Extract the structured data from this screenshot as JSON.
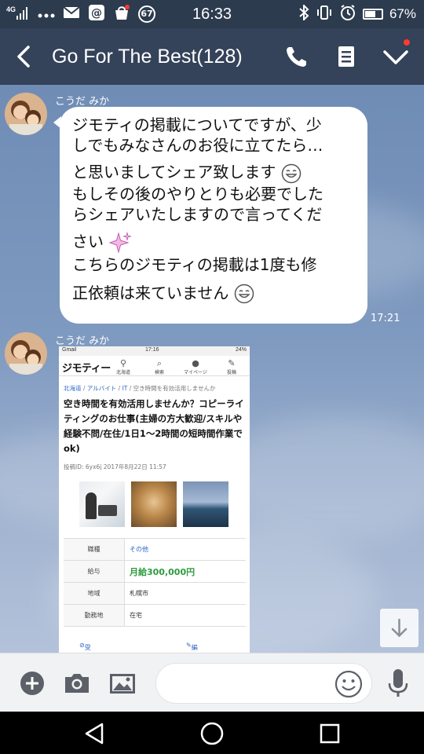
{
  "status_bar": {
    "network_type": "4G",
    "notification_count": "67",
    "time": "16:33",
    "battery_percent": "67%",
    "battery_level": 0.67
  },
  "header": {
    "title": "Go For The Best(128)"
  },
  "chat": {
    "messages": [
      {
        "sender": "こうだ みか",
        "lines": [
          "ジモティの掲載についてですが、少",
          "しでもみなさんのお役に立てたら…",
          "と思いましてシェア致します",
          "もしその後のやりとりも必要でした",
          "らシェアいたしますので言ってくだ",
          "さい",
          "こちらのジモティの掲載は1度も修",
          "正依頼は来ていません"
        ],
        "time": "17:21"
      },
      {
        "sender": "こうだ みか"
      }
    ]
  },
  "shared_screenshot": {
    "status_carrier": "Gmail",
    "status_time": "17:16",
    "status_battery": "24%",
    "logo": "ジモティー",
    "nav": [
      "北海道",
      "検索",
      "マイページ",
      "投稿"
    ],
    "breadcrumb": [
      "北海道",
      "アルバイト",
      "IT",
      "空き時間を有効活用しませんか"
    ],
    "title": "空き時間を有効活用しませんか？コピーライティングのお仕事(主婦の方大歓迎/スキルや経験不問/在住/1日1〜2時間の短時間作業でok)",
    "post_id": "投稿ID: 6yx6j 2017年8月22日 11:57",
    "table": [
      {
        "label": "職種",
        "value": "その他"
      },
      {
        "label": "給与",
        "value": "月給300,000円"
      },
      {
        "label": "地域",
        "value": "札幌市"
      },
      {
        "label": "勤務地",
        "value": "在宅"
      }
    ],
    "footer_left": "受付を終了",
    "footer_right": "編集"
  },
  "input": {
    "placeholder": ""
  },
  "colors": {
    "header_bg": "#34425a",
    "status_bg": "#2d3b4e",
    "chat_bg": "#7a93b8",
    "bubble_bg": "#ffffff",
    "link_blue": "#2a66c4",
    "salary_green": "#2e9a3e"
  },
  "icons": {
    "header": [
      "back-arrow-icon",
      "phone-icon",
      "notes-icon",
      "chevron-down-icon"
    ],
    "input_bar": [
      "plus-icon",
      "camera-icon",
      "image-icon",
      "emoji-icon",
      "microphone-icon"
    ],
    "nav": [
      "back-triangle-icon",
      "home-circle-icon",
      "recents-square-icon"
    ]
  }
}
